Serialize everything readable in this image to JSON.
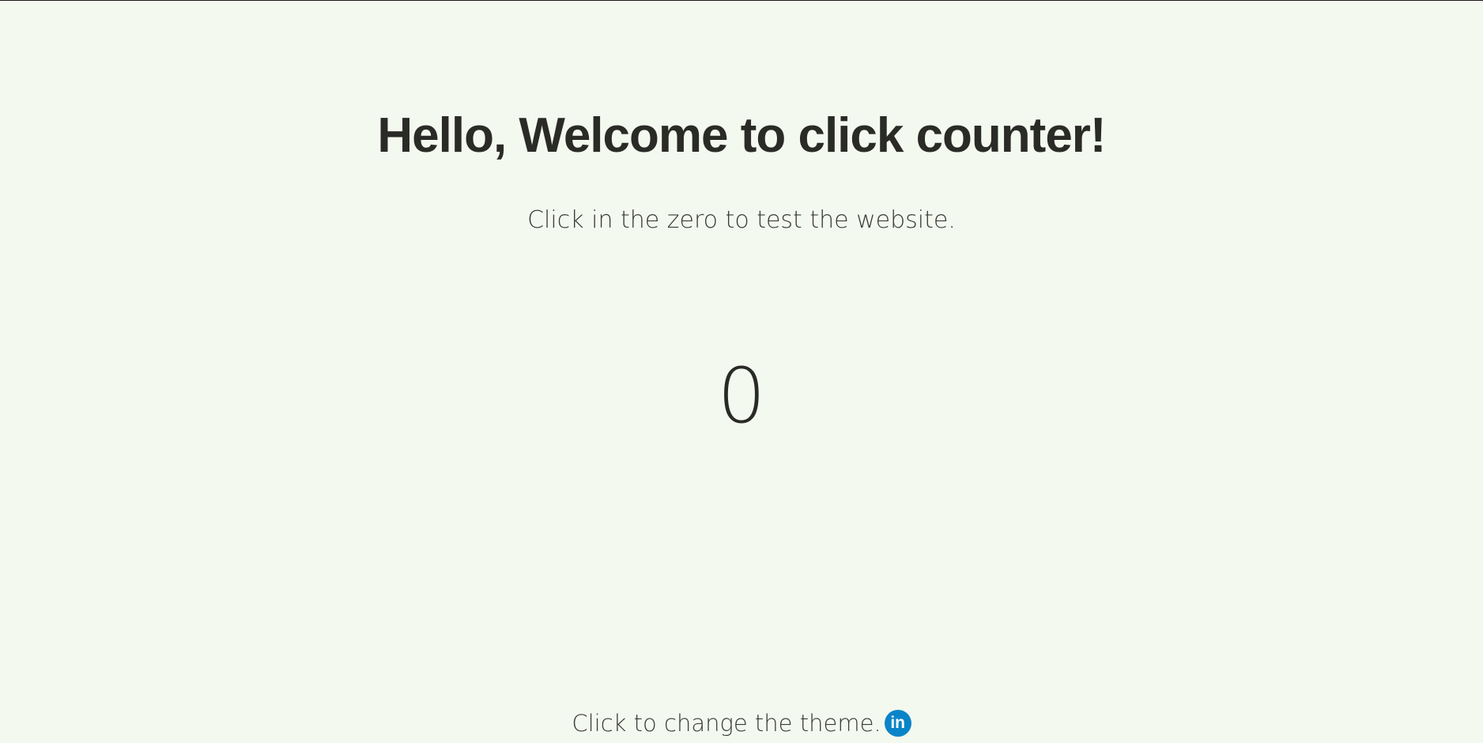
{
  "page": {
    "heading": "Hello, Welcome to click counter!",
    "subtitle": "Click in the zero to test the website.",
    "counter_value": "0"
  },
  "footer": {
    "theme_text": "Click to change the theme.",
    "social_icon": {
      "name": "linkedin-icon",
      "glyph": "in",
      "color": "#0a84c8"
    }
  },
  "colors": {
    "background": "#f4f9ef",
    "text": "#2a2b26"
  }
}
